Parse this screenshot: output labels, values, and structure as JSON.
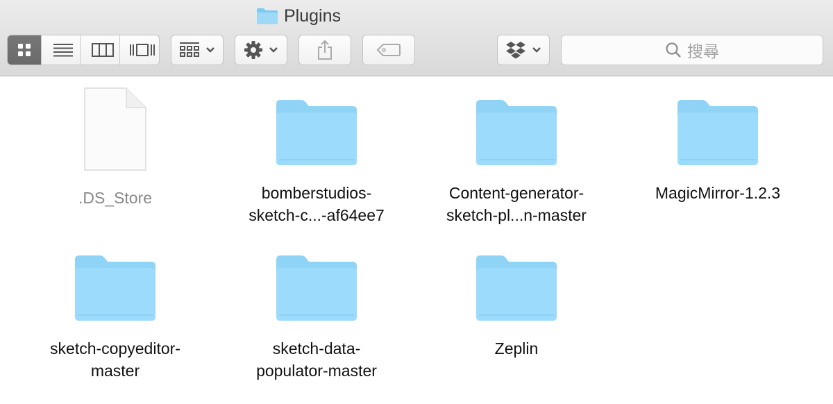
{
  "window": {
    "title": "Plugins"
  },
  "toolbar": {
    "view_modes": [
      "icon-view",
      "list-view",
      "column-view",
      "cover-flow-view"
    ],
    "active_view": "icon-view",
    "search_placeholder": "搜尋"
  },
  "files": [
    {
      "name": ".DS_Store",
      "kind": "document"
    },
    {
      "name": "bomberstudios-\nsketch-c...-af64ee7",
      "kind": "folder"
    },
    {
      "name": "Content-generator-\nsketch-pl...n-master",
      "kind": "folder"
    },
    {
      "name": "MagicMirror-1.2.3",
      "kind": "folder"
    },
    {
      "name": "sketch-copyeditor-\nmaster",
      "kind": "folder"
    },
    {
      "name": "sketch-data-\npopulator-master",
      "kind": "folder"
    },
    {
      "name": "Zeplin",
      "kind": "folder"
    }
  ],
  "colors": {
    "folder": "#8fd3f7",
    "folder_tab": "#b7e5fb",
    "selected_view": "#6f6f6f"
  }
}
